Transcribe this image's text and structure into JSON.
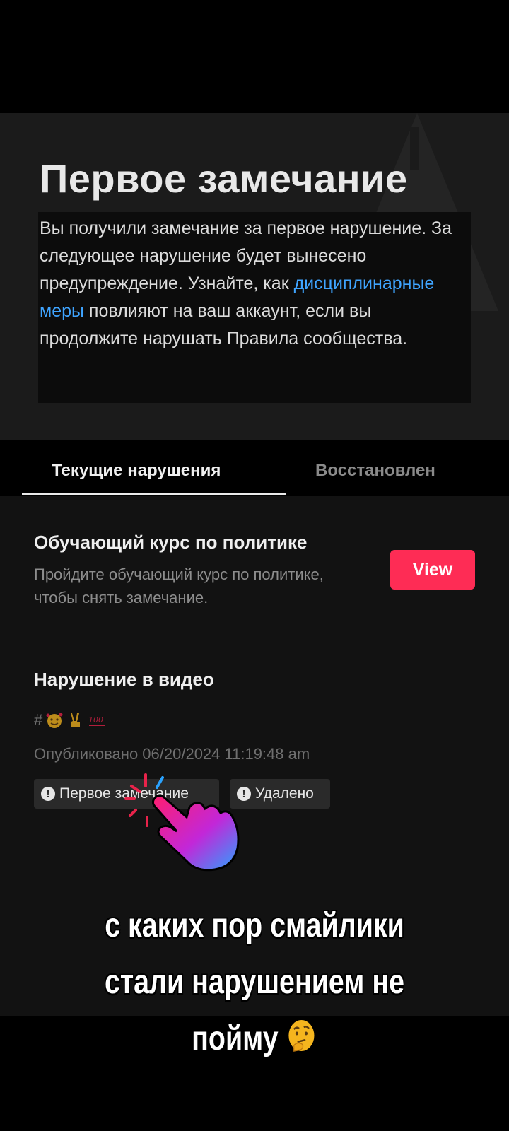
{
  "header": {
    "title": "Первое замечание",
    "desc_before_link": "Вы получили замечание за первое нарушение. За следующее нарушение будет вынесено предупреждение. Узнайте, как ",
    "desc_link": "дисциплинарные меры",
    "desc_after_link": " повлияют на ваш аккаунт, если вы продолжите нарушать Правила сообщества."
  },
  "tabs": {
    "current": "Текущие нарушения",
    "restored": "Восстановлен"
  },
  "course": {
    "title": "Обучающий курс по политике",
    "desc": "Пройдите обучающий курс по политике, чтобы снять замечание.",
    "button": "View"
  },
  "violation": {
    "title": "Нарушение в видео",
    "hashtag": "#",
    "emoji_icons": [
      "smiling-face-with-hearts-icon",
      "victory-hand-icon",
      "hundred-points-icon"
    ],
    "published": "Опубликовано 06/20/2024 11:19:48 am",
    "badge_first": "Первое замечание",
    "badge_removed": "Удалено"
  },
  "caption": {
    "line1": "с каких пор смайлики",
    "line2": "стали нарушением не",
    "line3": "пойму"
  },
  "colors": {
    "accent": "#fe2c55",
    "link": "#3fa4ff"
  }
}
